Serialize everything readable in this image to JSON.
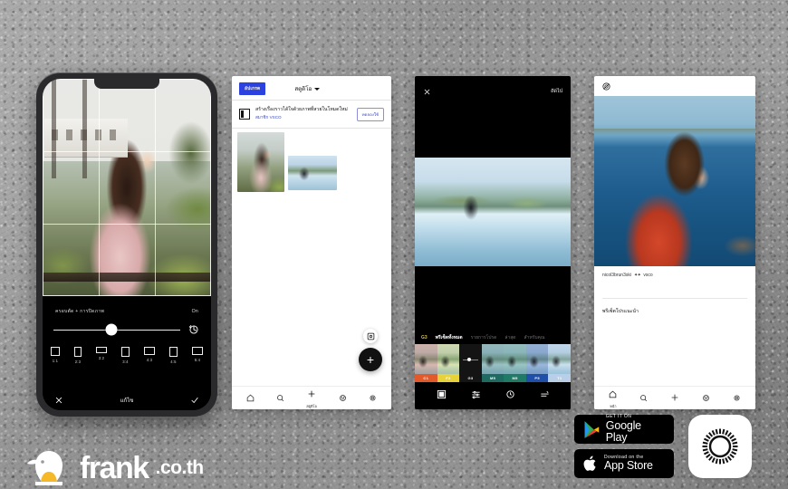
{
  "page": {
    "background_color": "#9a9a9a",
    "brand": {
      "name": "frank",
      "tld": ".co.th",
      "logo_icon": "penguin-icon"
    }
  },
  "phone1": {
    "name": "crop-editor-screen",
    "tool_label": "ครอบตัด + การปิดภาพ",
    "tool_value": "On",
    "rotate_icon": "rotate-icon",
    "slider_value": 46,
    "ratios": [
      {
        "label": "1:1",
        "w": 10,
        "h": 10
      },
      {
        "label": "2:3",
        "w": 8,
        "h": 11
      },
      {
        "label": "3:2",
        "w": 12,
        "h": 7
      },
      {
        "label": "3:4",
        "w": 9,
        "h": 11
      },
      {
        "label": "4:3",
        "w": 12,
        "h": 9
      },
      {
        "label": "4:5",
        "w": 9,
        "h": 11
      },
      {
        "label": "5:4",
        "w": 12,
        "h": 9
      }
    ],
    "cancel_icon": "close-icon",
    "confirm_icon": "check-icon",
    "footer_label": "แก้ไข"
  },
  "phone2": {
    "name": "studio-screen",
    "badge_label": "อัปเกรด",
    "title": "สตูดิโอ",
    "caret_icon": "chevron-down-icon",
    "card": {
      "icon": "book-icon",
      "title": "สร้างเรื่องราวได้ใจด้วยภาพที่สวยในโหมดใหม่",
      "subtitle": "สมาชิก VSCO",
      "action_label": "ทดลองใช้"
    },
    "thumbnails": [
      {
        "name": "thumb-girl-pink"
      },
      {
        "name": "thumb-pool"
      }
    ],
    "fab_small_icon": "image-settings-icon",
    "fab_icon": "plus-icon",
    "nav": [
      {
        "icon": "home-icon",
        "label": "",
        "active": false
      },
      {
        "icon": "search-icon",
        "label": "",
        "active": false
      },
      {
        "icon": "plus-icon",
        "label": "สตูดิโอ",
        "active": true
      },
      {
        "icon": "smiley-icon",
        "label": "",
        "active": false
      },
      {
        "icon": "gear-icon",
        "label": "",
        "active": false
      }
    ]
  },
  "phone3": {
    "name": "filter-editor-screen",
    "close_icon": "close-icon",
    "next_label": "ถัดไป",
    "preset_code": "G3",
    "tabs": [
      {
        "label": "พรีเซ็ตทั้งหมด",
        "active": true
      },
      {
        "label": "รายการโปรด",
        "active": false
      },
      {
        "label": "ล่าสุด",
        "active": false
      },
      {
        "label": "สำหรับคุณ",
        "active": false
      }
    ],
    "filters": [
      {
        "code": "C1",
        "color": "#e2592c",
        "selected": false
      },
      {
        "code": "F2",
        "color": "#e8d23a",
        "selected": false
      },
      {
        "code": "G3",
        "color": "#141414",
        "selected": true
      },
      {
        "code": "M5",
        "color": "#1f6b62",
        "selected": false
      },
      {
        "code": "M5",
        "color": "#1f7a66",
        "selected": false
      },
      {
        "code": "P5",
        "color": "#1f4fa8",
        "selected": false
      },
      {
        "code": "T1",
        "color": "#b9cfe8",
        "selected": false
      }
    ],
    "toolbar": [
      {
        "icon": "filter-square-icon"
      },
      {
        "icon": "adjust-sliders-icon"
      },
      {
        "icon": "history-icon"
      },
      {
        "icon": "edit-tools-icon"
      }
    ]
  },
  "phone4": {
    "name": "profile-feed-screen",
    "logo_icon": "vsco-logo-icon",
    "username": "nicol3brun3ski",
    "vsco_mark": "vsco",
    "section_label": "พรีเซ็ตโปรแนะนำ",
    "nav": [
      {
        "icon": "home-icon",
        "label": "หน้า",
        "active": true
      },
      {
        "icon": "search-icon",
        "label": "",
        "active": false
      },
      {
        "icon": "plus-icon",
        "label": "",
        "active": false
      },
      {
        "icon": "smiley-icon",
        "label": "",
        "active": false
      },
      {
        "icon": "gear-icon",
        "label": "",
        "active": false
      }
    ]
  },
  "store": {
    "google_play": {
      "small": "GET IT ON",
      "big": "Google Play",
      "icon": "google-play-icon"
    },
    "app_store": {
      "small": "Download on the",
      "big": "App Store",
      "icon": "apple-icon"
    },
    "app_icon": "vsco-app-icon"
  }
}
